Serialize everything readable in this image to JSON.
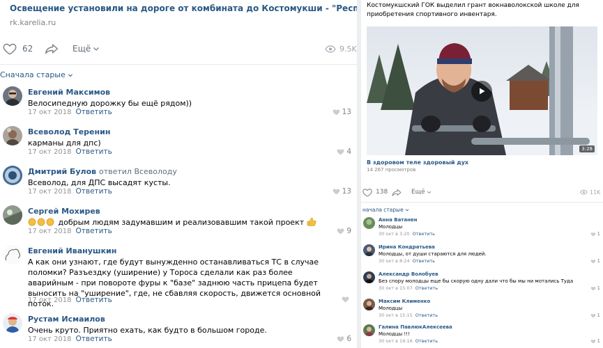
{
  "left": {
    "link": {
      "title": "Освещение установили на дороге от комбината до Костомукши - \"Республика\"",
      "domain": "rk.karelia.ru"
    },
    "actions": {
      "likes": "62",
      "more_label": "Ещё",
      "views": "9.5K"
    },
    "sort_label": "Сначала старые",
    "comments": [
      {
        "author": "Евгений Максимов",
        "reply_to": "",
        "text": "Велосипедную дорожку бы ещё рядом))",
        "date": "17 окт 2018",
        "reply_label": "Ответить",
        "likes": "13"
      },
      {
        "author": "Всеволод Теренин",
        "reply_to": "",
        "text": "карманы для дпс)",
        "date": "17 окт 2018",
        "reply_label": "Ответить",
        "likes": "4"
      },
      {
        "author": "Дмитрий Булов",
        "reply_to": "ответил Всеволоду",
        "text": "Всеволод, для ДПС высадят кусты.",
        "date": "17 окт 2018",
        "reply_label": "Ответить",
        "likes": "13"
      },
      {
        "author": "Сергей Мохирев",
        "reply_to": "",
        "text": "добрым людям задумавшим и реализовавшим такой проект",
        "date": "17 окт 2018",
        "reply_label": "Ответить",
        "likes": "9"
      },
      {
        "author": "Евгений Иванушкин",
        "reply_to": "",
        "text": "А как они узнают, где будут вынужденно останавливаться ТС в случае поломки? Разъездку (уширение) у Тороса сделали как раз более аварийным - при повороте фуры к \"базе\" заднюю часть прицепа будет выносить на \"уширение\", где, не сбавляя скорость, движется основной поток.",
        "date": "17 окт 2018",
        "reply_label": "Ответить",
        "likes": ""
      },
      {
        "author": "Рустам Исмаилов",
        "reply_to": "",
        "text": "Очень круто. Приятно ехать, как будто в большом городе.",
        "date": "17 окт 2018",
        "reply_label": "Ответить",
        "likes": "6"
      }
    ]
  },
  "right": {
    "post_text": "Костомукшский ГОК выделил грант вокнаволокской школе для приобретения спортивного инвентаря.",
    "video": {
      "duration": "3:28",
      "caption": "В здоровом теле здоровый дух",
      "views": "14 267 просмотров"
    },
    "actions": {
      "likes": "138",
      "more_label": "Ещё",
      "views": "11K"
    },
    "sort_label": "начала старые",
    "comments": [
      {
        "author": "Анна Ватанен",
        "text": "Молодцы",
        "date": "30 окт в 3:20",
        "reply_label": "Ответить",
        "likes": "1"
      },
      {
        "author": "Ирина Кондратьева",
        "text": "Молодцы, от души стараются для людей.",
        "date": "30 окт в 8:24",
        "reply_label": "Ответить",
        "likes": "1"
      },
      {
        "author": "Александр Волобуев",
        "text": "Без спору молодцы еще бы скорую одну дали что бы мы ни мотались Туда",
        "date": "30 окт в 15:07",
        "reply_label": "Ответить",
        "likes": "1"
      },
      {
        "author": "Максим Клименко",
        "text": "Молодцы",
        "date": "30 окт в 15:15",
        "reply_label": "Ответить",
        "likes": "1"
      },
      {
        "author": "Галина ПавлюкАлексеева",
        "text": "Молодцы !!!",
        "date": "30 окт в 19:16",
        "reply_label": "Ответить",
        "likes": "1"
      }
    ]
  },
  "icons": [
    "heart-icon",
    "share-icon",
    "chevron-down-icon",
    "eye-icon",
    "play-icon",
    "clapping-hands-icon",
    "thumbs-up-icon"
  ],
  "colors": {
    "link": "#2a5885",
    "muted": "#828282",
    "divider": "#e7e8ec",
    "panel_gap": "#edeef0"
  }
}
